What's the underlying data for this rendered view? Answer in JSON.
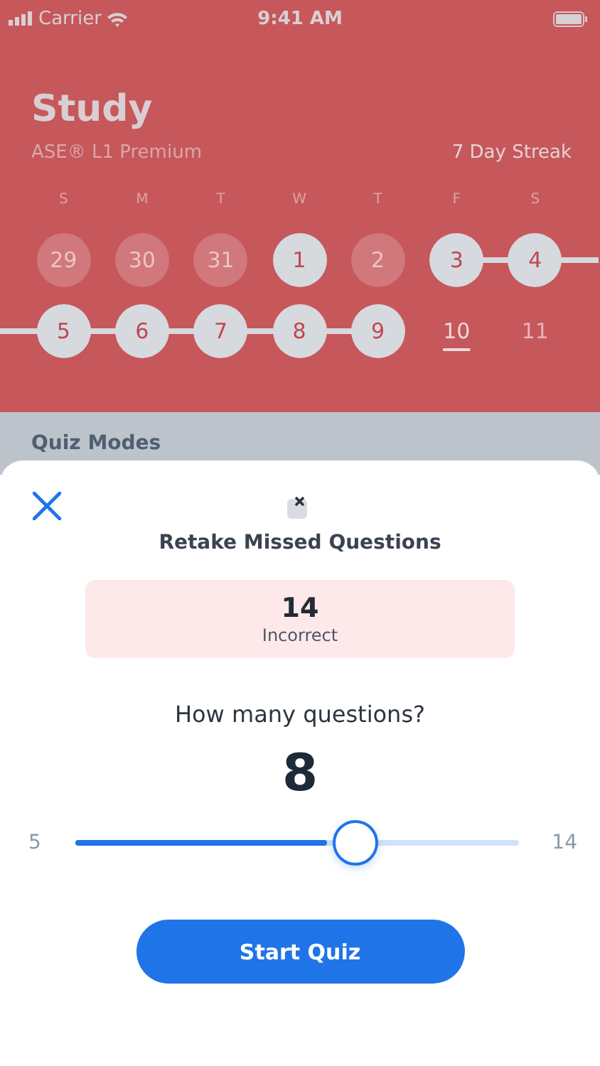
{
  "status_bar": {
    "carrier": "Carrier",
    "time": "9:41 AM"
  },
  "header": {
    "title": "Study",
    "subtitle": "ASE® L1 Premium",
    "streak": "7 Day Streak"
  },
  "calendar": {
    "weekdays": [
      "S",
      "M",
      "T",
      "W",
      "T",
      "F",
      "S"
    ],
    "weeks": [
      [
        {
          "label": "29",
          "kind": "inactive",
          "streak": false
        },
        {
          "label": "30",
          "kind": "inactive",
          "streak": false
        },
        {
          "label": "31",
          "kind": "inactive",
          "streak": false
        },
        {
          "label": "1",
          "kind": "studied",
          "streak": false
        },
        {
          "label": "2",
          "kind": "inactive",
          "streak": false
        },
        {
          "label": "3",
          "kind": "studied",
          "streak": true
        },
        {
          "label": "4",
          "kind": "studied",
          "streak": true
        }
      ],
      [
        {
          "label": "5",
          "kind": "studied",
          "streak": true
        },
        {
          "label": "6",
          "kind": "studied",
          "streak": true
        },
        {
          "label": "7",
          "kind": "studied",
          "streak": true
        },
        {
          "label": "8",
          "kind": "studied",
          "streak": true
        },
        {
          "label": "9",
          "kind": "studied",
          "streak": true
        },
        {
          "label": "10",
          "kind": "today",
          "streak": false
        },
        {
          "label": "11",
          "kind": "upcoming",
          "streak": false
        }
      ]
    ]
  },
  "section_title": "Quiz Modes",
  "sheet": {
    "title": "Retake Missed Questions",
    "stat": {
      "value": "14",
      "label": "Incorrect"
    },
    "question": "How many questions?",
    "count": "8",
    "slider": {
      "min": "5",
      "max": "14",
      "level": 0.57
    },
    "button": "Start Quiz"
  }
}
